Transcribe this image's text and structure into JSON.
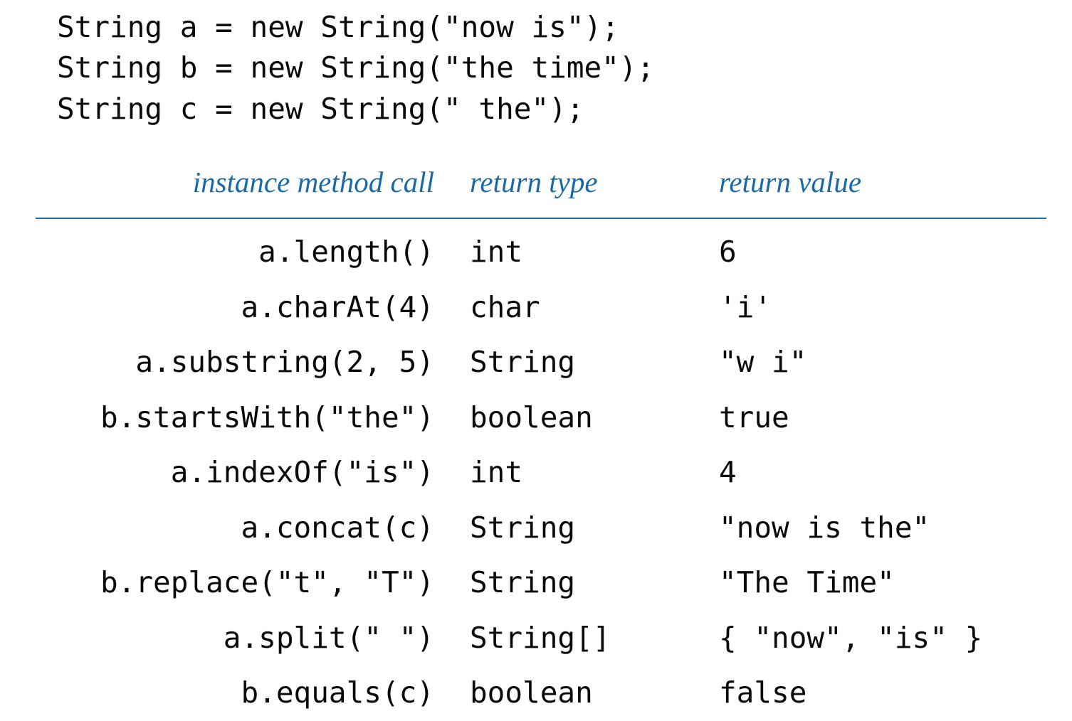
{
  "code_lines": [
    "String a = new String(\"now is\");",
    "String b = new String(\"the time\");",
    "String c = new String(\" the\");"
  ],
  "table": {
    "headers": {
      "call": "instance method call",
      "type": "return type",
      "value": "return value"
    },
    "rows": [
      {
        "call": "a.length()",
        "type": "int",
        "value": "6"
      },
      {
        "call": "a.charAt(4)",
        "type": "char",
        "value": "'i'"
      },
      {
        "call": "a.substring(2, 5)",
        "type": "String",
        "value": "\"w i\""
      },
      {
        "call": "b.startsWith(\"the\")",
        "type": "boolean",
        "value": "true"
      },
      {
        "call": "a.indexOf(\"is\")",
        "type": "int",
        "value": "4"
      },
      {
        "call": "a.concat(c)",
        "type": "String",
        "value": "\"now is the\""
      },
      {
        "call": "b.replace(\"t\", \"T\")",
        "type": "String",
        "value": "\"The Time\""
      },
      {
        "call": "a.split(\" \")",
        "type": "String[]",
        "value": "{ \"now\", \"is\" }"
      },
      {
        "call": "b.equals(c)",
        "type": "boolean",
        "value": "false"
      }
    ]
  }
}
